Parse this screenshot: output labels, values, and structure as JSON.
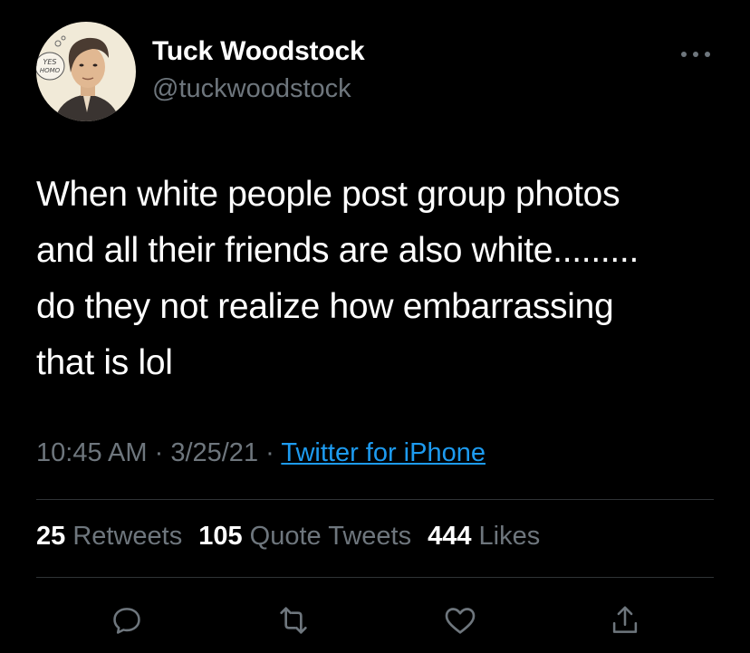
{
  "author": {
    "display_name": "Tuck Woodstock",
    "handle": "@tuckwoodstock",
    "avatar_sign_text": "YES HOMO"
  },
  "tweet": {
    "lines": [
      "When white people post group photos",
      "and all their friends are also white.........",
      "do they not realize how embarrassing",
      "that is lol"
    ]
  },
  "meta": {
    "time": "10:45 AM",
    "sep1": " · ",
    "date": "3/25/21",
    "sep2": " · ",
    "source": "Twitter for iPhone"
  },
  "stats": {
    "retweets_count": "25",
    "retweets_label": "Retweets",
    "quotes_count": "105",
    "quotes_label": "Quote Tweets",
    "likes_count": "444",
    "likes_label": "Likes"
  },
  "actions": {
    "icons": [
      "reply-icon",
      "retweet-icon",
      "like-icon",
      "share-icon"
    ]
  },
  "colors": {
    "background": "#000000",
    "text_primary": "#ffffff",
    "text_secondary": "#6e767d",
    "link": "#1d9bf0",
    "divider": "#2f3336"
  }
}
